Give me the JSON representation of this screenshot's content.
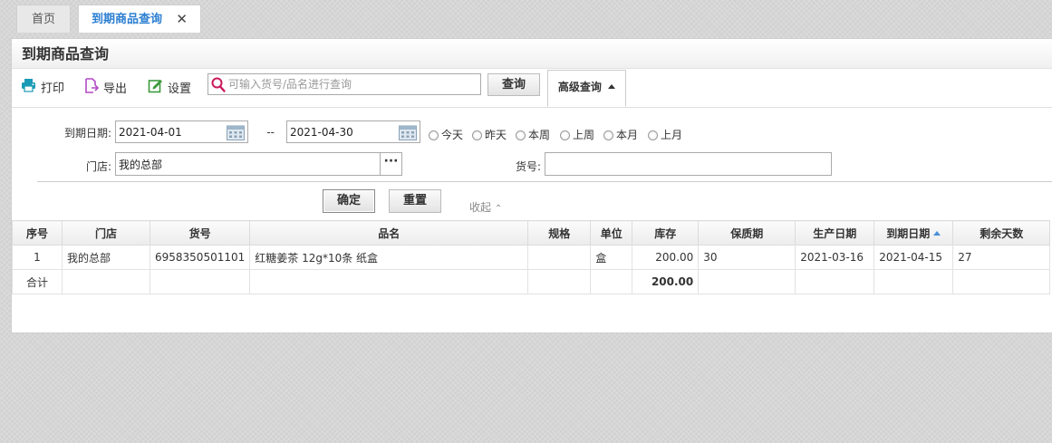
{
  "tabs": [
    {
      "label": "首页",
      "active": false
    },
    {
      "label": "到期商品查询",
      "active": true,
      "close": "✕"
    }
  ],
  "page_title": "到期商品查询",
  "toolbar": {
    "print_label": "打印",
    "export_label": "导出",
    "settings_label": "设置",
    "search_placeholder": "可输入货号/品名进行查询",
    "search_value": "",
    "query_label": "查询",
    "advanced_label": "高级查询"
  },
  "filter": {
    "date_label": "到期日期:",
    "date_from": "2021-04-01",
    "date_sep": "--",
    "date_to": "2021-04-30",
    "quick_ranges": [
      "今天",
      "昨天",
      "本周",
      "上周",
      "本月",
      "上月"
    ],
    "store_label": "门店:",
    "store_value": "我的总部",
    "store_picker": "···",
    "sku_label": "货号:",
    "sku_value": "",
    "ok_label": "确定",
    "reset_label": "重置",
    "collapse_label": "收起",
    "collapse_arrow": "^"
  },
  "table": {
    "columns": [
      "序号",
      "门店",
      "货号",
      "品名",
      "规格",
      "单位",
      "库存",
      "保质期",
      "生产日期",
      "到期日期",
      "剩余天数"
    ],
    "sorted_column": "到期日期",
    "rows": [
      [
        "1",
        "我的总部",
        "6958350501101",
        "红糖姜茶 12g*10条 纸盒",
        "",
        "盒",
        "200.00",
        "30",
        "2021-03-16",
        "2021-04-15",
        "27"
      ]
    ],
    "total": {
      "label": "合计",
      "stock": "200.00"
    }
  },
  "colors": {
    "accent": "#2c7fd1",
    "print_icon": "#1a9bb5",
    "export_icon": "#b24bc4",
    "settings_icon": "#3d9a3d",
    "search_icon": "#c9185b"
  }
}
